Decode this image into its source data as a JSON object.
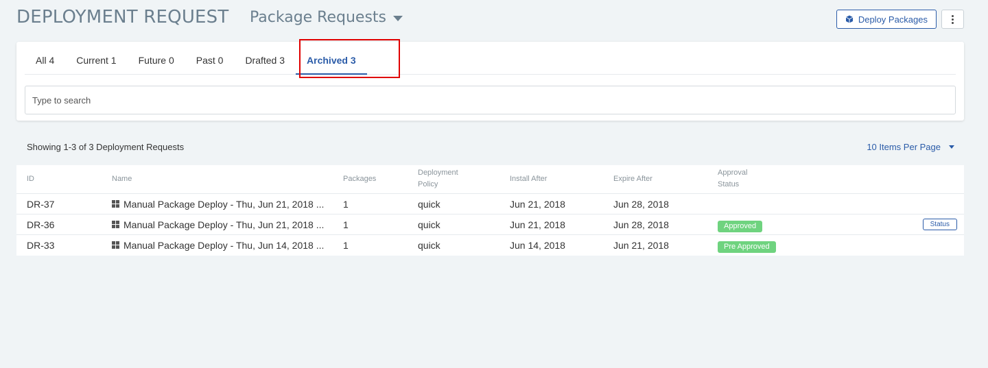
{
  "header": {
    "title": "DEPLOYMENT REQUEST",
    "subtitle": "Package Requests",
    "deploy_label": "Deploy Packages"
  },
  "tabs": [
    {
      "label": "All 4",
      "active": false
    },
    {
      "label": "Current 1",
      "active": false
    },
    {
      "label": "Future 0",
      "active": false
    },
    {
      "label": "Past 0",
      "active": false
    },
    {
      "label": "Drafted 3",
      "active": false
    },
    {
      "label": "Archived 3",
      "active": true
    }
  ],
  "search": {
    "placeholder": "Type to search"
  },
  "summary": {
    "showing": "Showing 1-3 of 3 Deployment Requests",
    "per_page": "10 Items Per Page"
  },
  "table": {
    "columns": {
      "id": "ID",
      "name": "Name",
      "packages": "Packages",
      "policy_1": "Deployment",
      "policy_2": "Policy",
      "install": "Install After",
      "expire": "Expire After",
      "approval_1": "Approval",
      "approval_2": "Status"
    },
    "rows": [
      {
        "id": "DR-37",
        "name": "Manual Package Deploy - Thu, Jun 21, 2018 ...",
        "packages": "1",
        "policy": "quick",
        "install": "Jun 21, 2018",
        "expire": "Jun 28, 2018",
        "approval": "",
        "status_button": ""
      },
      {
        "id": "DR-36",
        "name": "Manual Package Deploy - Thu, Jun 21, 2018 ...",
        "packages": "1",
        "policy": "quick",
        "install": "Jun 21, 2018",
        "expire": "Jun 28, 2018",
        "approval": "Approved",
        "status_button": "Status"
      },
      {
        "id": "DR-33",
        "name": "Manual Package Deploy - Thu, Jun 14, 2018 ...",
        "packages": "1",
        "policy": "quick",
        "install": "Jun 14, 2018",
        "expire": "Jun 21, 2018",
        "approval": "Pre Approved",
        "status_button": ""
      }
    ]
  },
  "colors": {
    "accent": "#2a5ba8",
    "badge_green": "#6fd37f",
    "highlight": "#e00000"
  },
  "icons": {
    "deploy": "cube-icon",
    "more": "vertical-dots-icon",
    "os": "windows-icon"
  }
}
